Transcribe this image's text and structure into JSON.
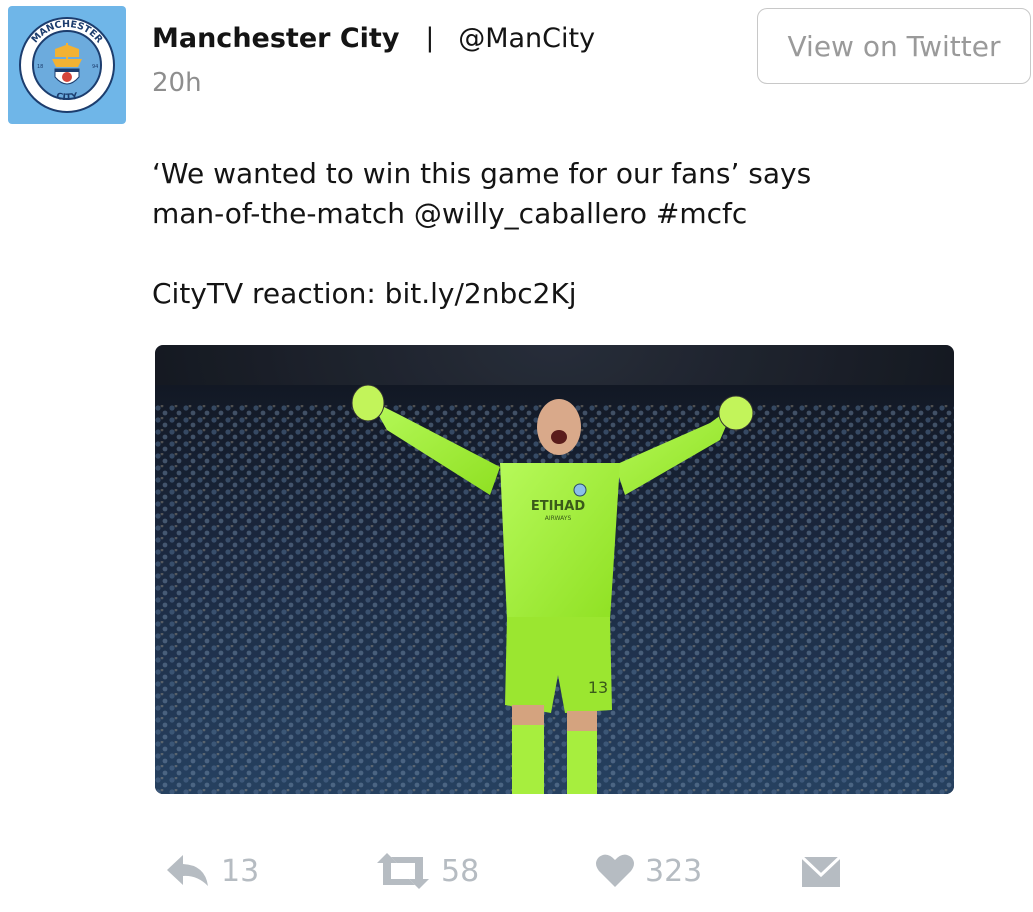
{
  "header": {
    "display_name": "Manchester City",
    "separator": "|",
    "handle": "@ManCity",
    "timestamp": "20h",
    "view_button": "View on Twitter",
    "avatar": {
      "background": "#6fb6e8",
      "badge_text_top": "MANCHESTER",
      "badge_text_bottom": "CITY",
      "badge_year_left": "18",
      "badge_year_right": "94"
    }
  },
  "tweet": {
    "line1": "‘We wanted to win this game for our fans’ says",
    "line2": "man-of-the-match @willy_caballero #mcfc",
    "line3": "CityTV reaction: bit.ly/2nbc2Kj"
  },
  "photo": {
    "jersey_sponsor": "ETIHAD",
    "jersey_sponsor_sub": "AIRWAYS",
    "shorts_number": "13",
    "kit_color": "#a6f23c",
    "crowd_color": "#1a2a44"
  },
  "actions": {
    "reply": {
      "icon": "reply-icon",
      "count": "13"
    },
    "retweet": {
      "icon": "retweet-icon",
      "count": "58"
    },
    "like": {
      "icon": "heart-icon",
      "count": "323"
    },
    "dm": {
      "icon": "envelope-icon"
    },
    "icon_color": "#b6bcc2"
  }
}
